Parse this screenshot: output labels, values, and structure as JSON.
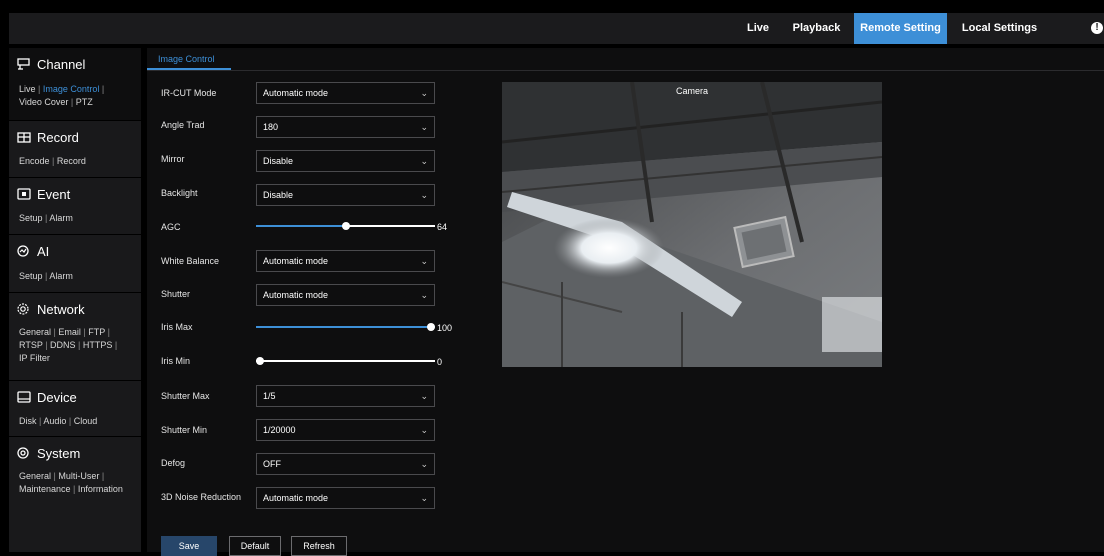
{
  "topnav": {
    "items": [
      {
        "label": "Live",
        "active": false
      },
      {
        "label": "Playback",
        "active": false
      },
      {
        "label": "Remote Setting",
        "active": true
      },
      {
        "label": "Local Settings",
        "active": false
      }
    ],
    "info_icon": "info-icon",
    "info_glyph": "!"
  },
  "sidebar": {
    "sections": [
      {
        "title": "Channel",
        "icon": "channel-icon",
        "links": [
          "Live",
          "Image Control",
          "Video Cover",
          "PTZ"
        ],
        "active_link": "Image Control"
      },
      {
        "title": "Record",
        "icon": "record-icon",
        "links": [
          "Encode",
          "Record"
        ]
      },
      {
        "title": "Event",
        "icon": "event-icon",
        "links": [
          "Setup",
          "Alarm"
        ]
      },
      {
        "title": "AI",
        "icon": "ai-icon",
        "links": [
          "Setup",
          "Alarm"
        ]
      },
      {
        "title": "Network",
        "icon": "network-icon",
        "links": [
          "General",
          "Email",
          "FTP",
          "RTSP",
          "DDNS",
          "HTTPS",
          "IP Filter"
        ]
      },
      {
        "title": "Device",
        "icon": "device-icon",
        "links": [
          "Disk",
          "Audio",
          "Cloud"
        ]
      },
      {
        "title": "System",
        "icon": "system-icon",
        "links": [
          "General",
          "Multi-User",
          "Maintenance",
          "Information"
        ]
      }
    ]
  },
  "tab": {
    "label": "Image Control"
  },
  "form": {
    "ir_cut": {
      "label": "IR-CUT Mode",
      "value": "Automatic mode"
    },
    "angle_trad": {
      "label": "Angle Trad",
      "value": "180"
    },
    "mirror": {
      "label": "Mirror",
      "value": "Disable"
    },
    "backlight": {
      "label": "Backlight",
      "value": "Disable"
    },
    "agc": {
      "label": "AGC",
      "value": "64",
      "fraction": 0.5
    },
    "white_balance": {
      "label": "White Balance",
      "value": "Automatic mode"
    },
    "shutter": {
      "label": "Shutter",
      "value": "Automatic mode"
    },
    "iris_max": {
      "label": "Iris Max",
      "value": "100",
      "fraction": 1.0
    },
    "iris_min": {
      "label": "Iris Min",
      "value": "0",
      "fraction": 0.0
    },
    "shutter_max": {
      "label": "Shutter Max",
      "value": "1/5"
    },
    "shutter_min": {
      "label": "Shutter Min",
      "value": "1/20000"
    },
    "defog": {
      "label": "Defog",
      "value": "OFF"
    },
    "noise_reduction": {
      "label": "3D Noise Reduction",
      "value": "Automatic mode"
    }
  },
  "buttons": {
    "save": "Save",
    "default": "Default",
    "refresh": "Refresh"
  },
  "preview": {
    "title": "Camera"
  },
  "colors": {
    "accent": "#3d8fd7",
    "topbar": "#1b1b1d",
    "sidebar": "#19191b",
    "panel": "#0e0e0f",
    "save_button": "#27466a"
  }
}
